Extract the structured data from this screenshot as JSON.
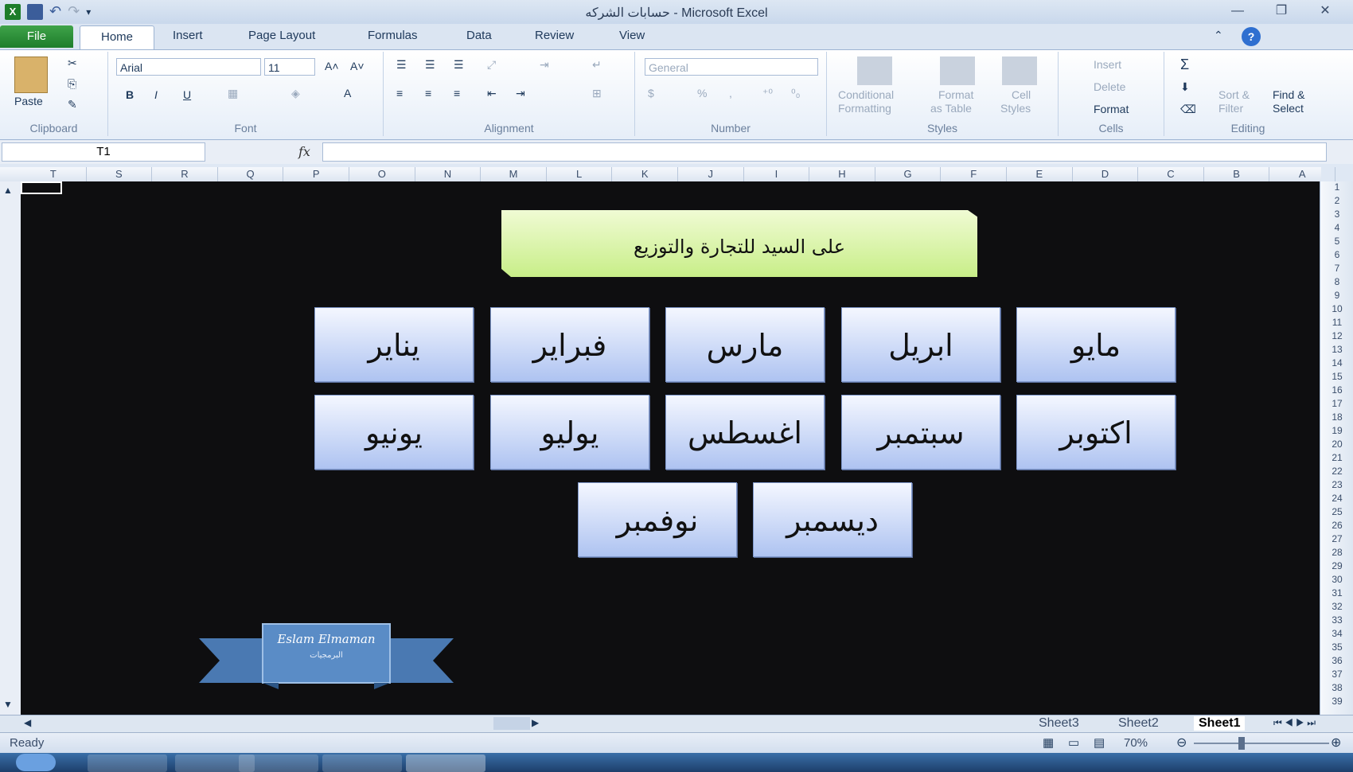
{
  "window": {
    "title": "حسابات الشركه  -  Microsoft Excel",
    "controls": [
      "—",
      "❐",
      "✕"
    ]
  },
  "tabs": {
    "file": "File",
    "items": [
      "Home",
      "Insert",
      "Page Layout",
      "Formulas",
      "Data",
      "Review",
      "View"
    ]
  },
  "ribbon": {
    "clipboard": {
      "label": "Clipboard",
      "paste": "Paste"
    },
    "font": {
      "label": "Font",
      "font_name": "Arial",
      "font_size": "11",
      "bold": "B",
      "italic": "I",
      "underline": "U",
      "grow": "A˄",
      "shrink": "A˅",
      "color": "A"
    },
    "alignment": {
      "label": "Alignment"
    },
    "number": {
      "label": "Number",
      "format": "General",
      "percent": "%",
      "comma": ","
    },
    "styles": {
      "label": "Styles",
      "conditional": "Conditional",
      "conditional2": "Formatting",
      "format_table": "Format",
      "format_table2": "as Table",
      "cell_styles": "Cell",
      "cell_styles2": "Styles"
    },
    "cells": {
      "label": "Cells",
      "insert": "Insert",
      "delete": "Delete",
      "format": "Format"
    },
    "editing": {
      "label": "Editing",
      "sum": "Σ",
      "sort": "Sort &",
      "sort2": "Filter",
      "find": "Find &",
      "find2": "Select"
    }
  },
  "formula_bar": {
    "name_box": "T1",
    "fx": "fx",
    "value": ""
  },
  "columns": [
    "T",
    "S",
    "R",
    "Q",
    "P",
    "O",
    "N",
    "M",
    "L",
    "K",
    "J",
    "I",
    "H",
    "G",
    "F",
    "E",
    "D",
    "C",
    "B",
    "A"
  ],
  "rows": [
    "1",
    "2",
    "3",
    "4",
    "5",
    "6",
    "7",
    "8",
    "9",
    "10",
    "11",
    "12",
    "13",
    "14",
    "15",
    "16",
    "17",
    "18",
    "19",
    "20",
    "21",
    "22",
    "23",
    "24",
    "25",
    "26",
    "27",
    "28",
    "29",
    "30",
    "31",
    "32",
    "33",
    "34",
    "35",
    "36",
    "37",
    "38",
    "39"
  ],
  "sheet": {
    "banner": "على السيد للتجارة والتوزيع",
    "months_row1": [
      "يناير",
      "فبراير",
      "مارس",
      "ابريل",
      "مايو"
    ],
    "months_row2": [
      "يونيو",
      "يوليو",
      "اغسطس",
      "سبتمبر",
      "اكتوبر"
    ],
    "months_row3": [
      "نوفمبر",
      "ديسمبر"
    ],
    "logo_text": "Eslam Elmaman",
    "logo_sub": "البرمجيات"
  },
  "sheet_tabs": [
    "Sheet3",
    "Sheet2",
    "Sheet1"
  ],
  "status": {
    "ready": "Ready",
    "zoom": "70%"
  },
  "colors": {
    "sheet_bg": "#0e0e10",
    "banner": "#d4f29a",
    "month_button": "#bcd0f4",
    "file_tab": "#2b8f37"
  }
}
